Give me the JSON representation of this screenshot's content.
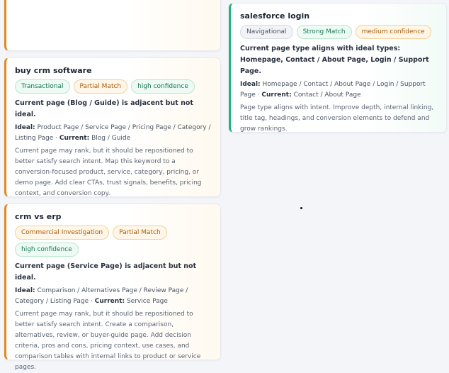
{
  "cards": [
    {
      "keyword": "salesforce login",
      "tags": [
        "Navigational",
        "Strong Match",
        "medium confidence"
      ],
      "summary": "Current page type aligns with ideal types: Homepage, Contact / About Page, Login / Support Page.",
      "ideal_label": "Ideal:",
      "ideal": "Homepage / Contact / About Page / Login / Support Page",
      "sep": " · ",
      "current_label": "Current:",
      "current": "Contact / About Page",
      "description": "Page type aligns with intent. Improve depth, internal linking, title tag, headings, and conversion elements to defend and grow rankings."
    },
    {
      "keyword": "buy crm software",
      "tags": [
        "Transactional",
        "Partial Match",
        "high confidence"
      ],
      "summary": "Current page (Blog / Guide) is adjacent but not ideal.",
      "ideal_label": "Ideal:",
      "ideal": "Product Page / Service Page / Pricing Page / Category / Listing Page",
      "sep": " · ",
      "current_label": "Current:",
      "current": "Blog / Guide",
      "description": "Current page may rank, but it should be repositioned to better satisfy search intent. Map this keyword to a conversion-focused product, service, category, pricing, or demo page. Add clear CTAs, trust signals, benefits, pricing context, and conversion copy."
    },
    {
      "keyword": "crm vs erp",
      "tags": [
        "Commercial Investigation",
        "Partial Match",
        "high confidence"
      ],
      "summary": "Current page (Service Page) is adjacent but not ideal.",
      "ideal_label": "Ideal:",
      "ideal": "Comparison / Alternatives Page / Review Page / Category / Listing Page",
      "sep": " · ",
      "current_label": "Current:",
      "current": "Service Page",
      "description": "Current page may rank, but it should be repositioned to better satisfy search intent. Create a comparison, alternatives, review, or buyer-guide page. Add decision criteria, pros and cons, pricing context, use cases, and comparison tables with internal links to product or service pages."
    }
  ]
}
